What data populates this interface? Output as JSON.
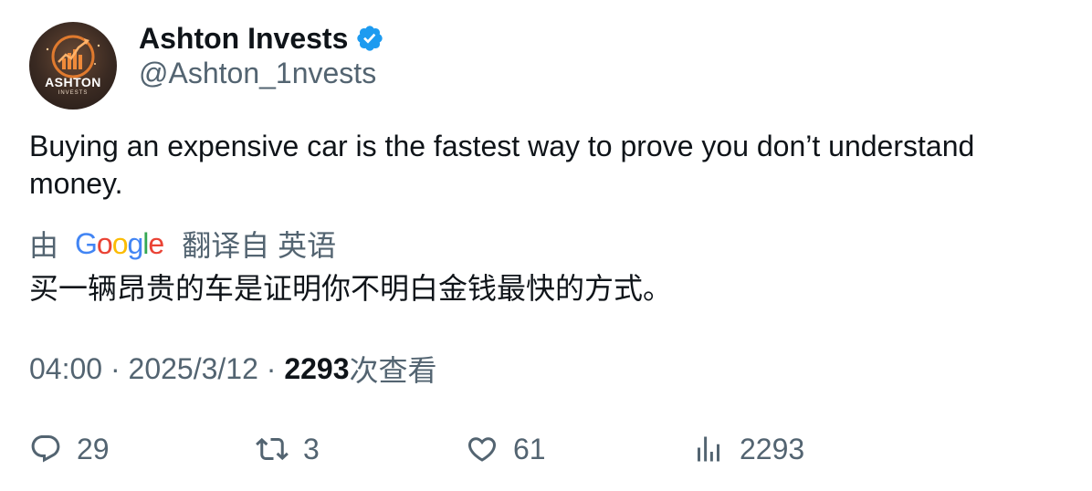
{
  "author": {
    "display_name": "Ashton Invests",
    "handle": "@Ashton_1nvests",
    "verified_icon": "verified-badge-icon",
    "avatar": {
      "title": "ASHTON",
      "subtitle": "INVESTS"
    }
  },
  "tweet": {
    "text": "Buying an expensive car is the fastest way to prove you don’t understand money."
  },
  "translation": {
    "prefix": "由",
    "provider": "Google",
    "suffix": "翻译自 英语",
    "text": "买一辆昂贵的车是证明你不明白金钱最快的方式。"
  },
  "meta": {
    "time": "04:00",
    "separator": " · ",
    "date": "2025/3/12",
    "views_count": "2293",
    "views_label": "次查看"
  },
  "actions": {
    "reply": {
      "icon": "reply-icon",
      "count": "29"
    },
    "retweet": {
      "icon": "retweet-icon",
      "count": "3"
    },
    "like": {
      "icon": "heart-icon",
      "count": "61"
    },
    "views": {
      "icon": "analytics-icon",
      "count": "2293"
    }
  },
  "colors": {
    "text_primary": "#0f1419",
    "text_secondary": "#536471",
    "verified_blue": "#1d9bf0"
  }
}
